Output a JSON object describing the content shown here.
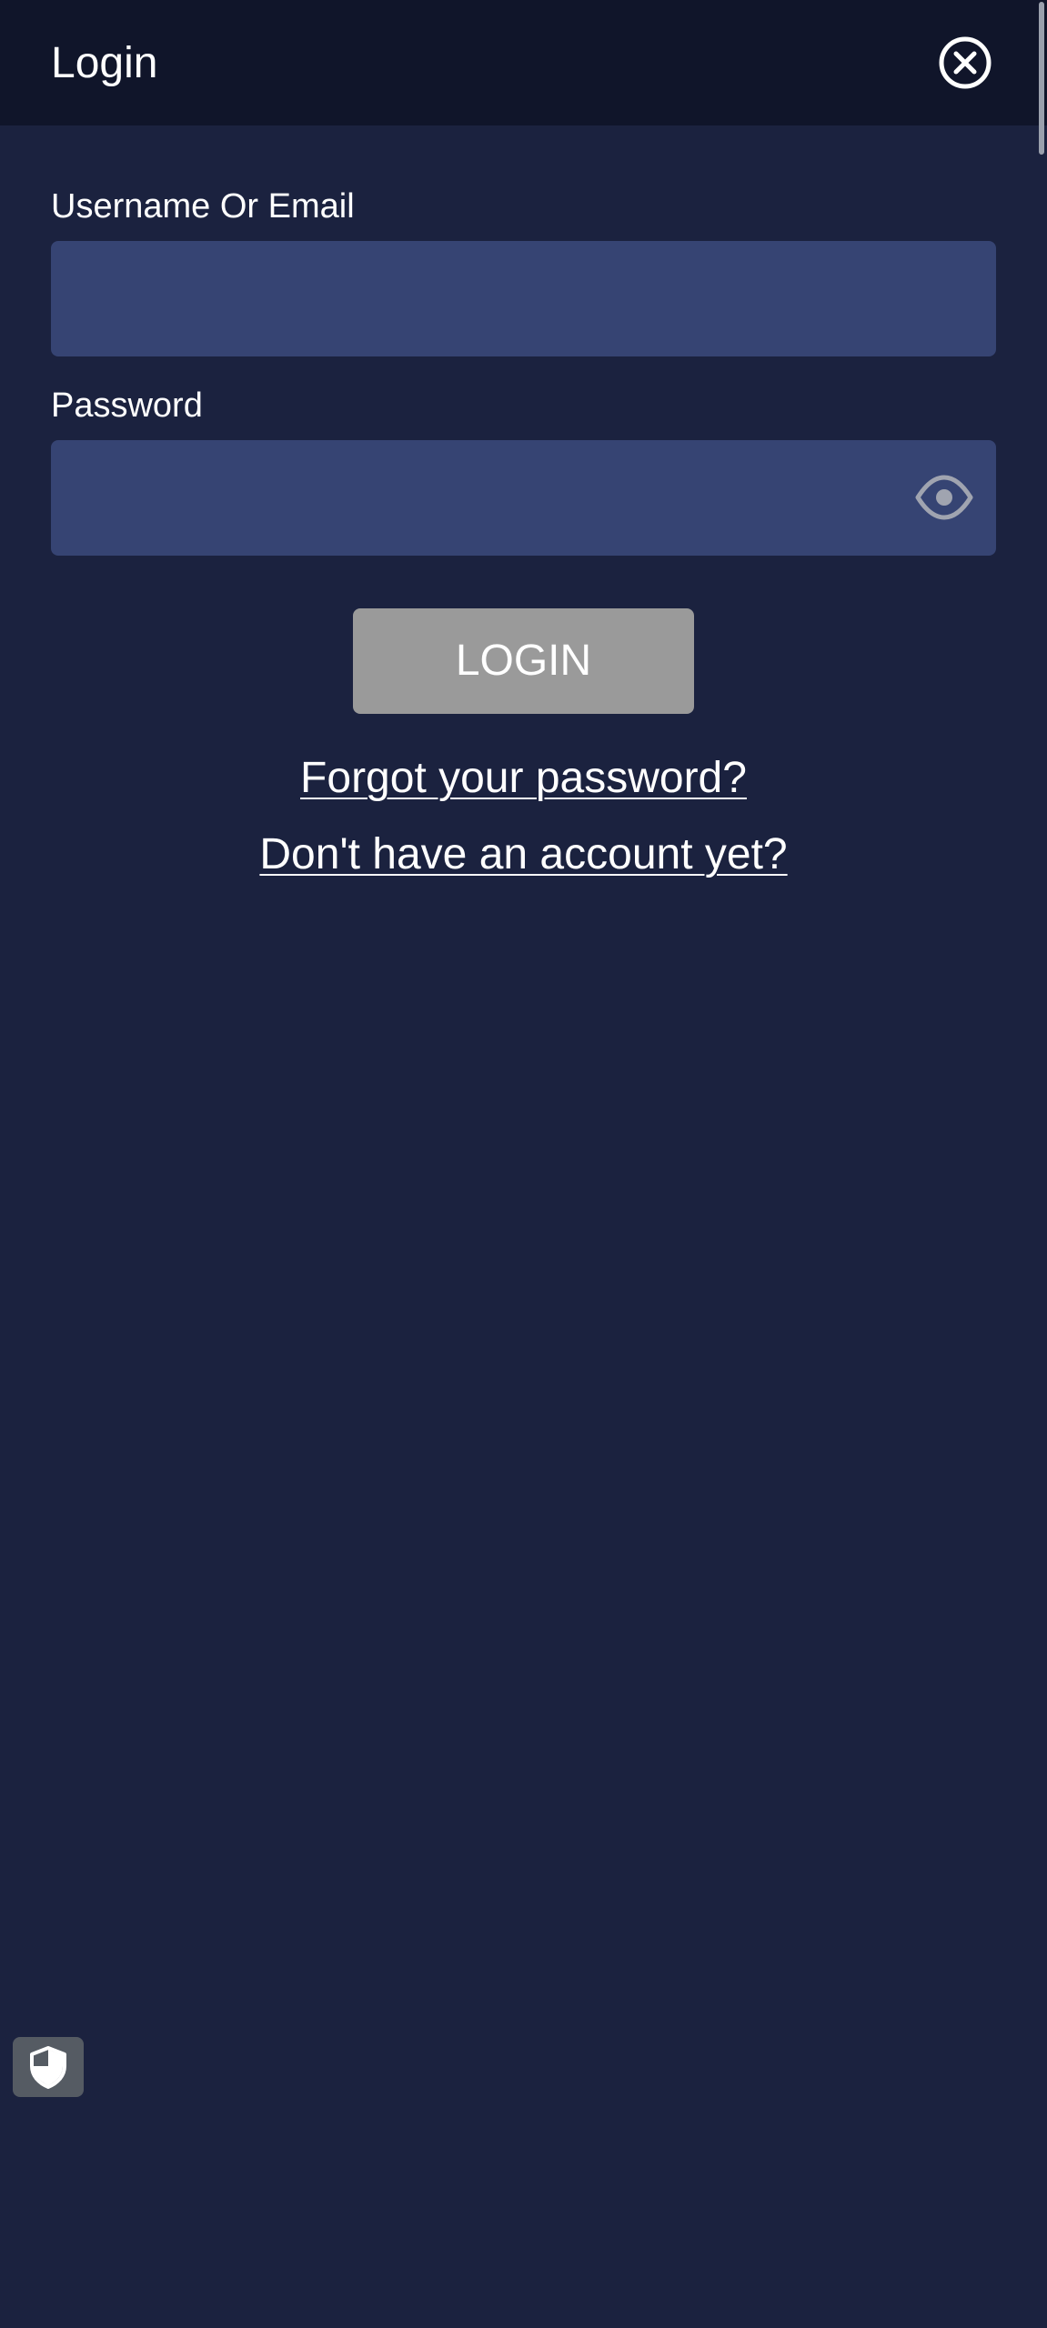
{
  "header": {
    "title": "Login",
    "close_icon": "close-circle-icon"
  },
  "form": {
    "username": {
      "label": "Username Or Email",
      "value": "",
      "placeholder": ""
    },
    "password": {
      "label": "Password",
      "value": "",
      "placeholder": "",
      "toggle_icon": "eye-icon"
    },
    "login_button": "LOGIN"
  },
  "links": {
    "forgot_password": "Forgot your password?",
    "register": "Don't have an account yet?"
  },
  "floating": {
    "shield_icon": "shield-icon"
  },
  "colors": {
    "background": "#1b223f",
    "header_background": "#10152a",
    "input_background": "#364473",
    "button_disabled": "#9a9a9a",
    "text": "#ffffff",
    "eye_icon": "#a0a4b0",
    "shield_button": "#555b63"
  }
}
